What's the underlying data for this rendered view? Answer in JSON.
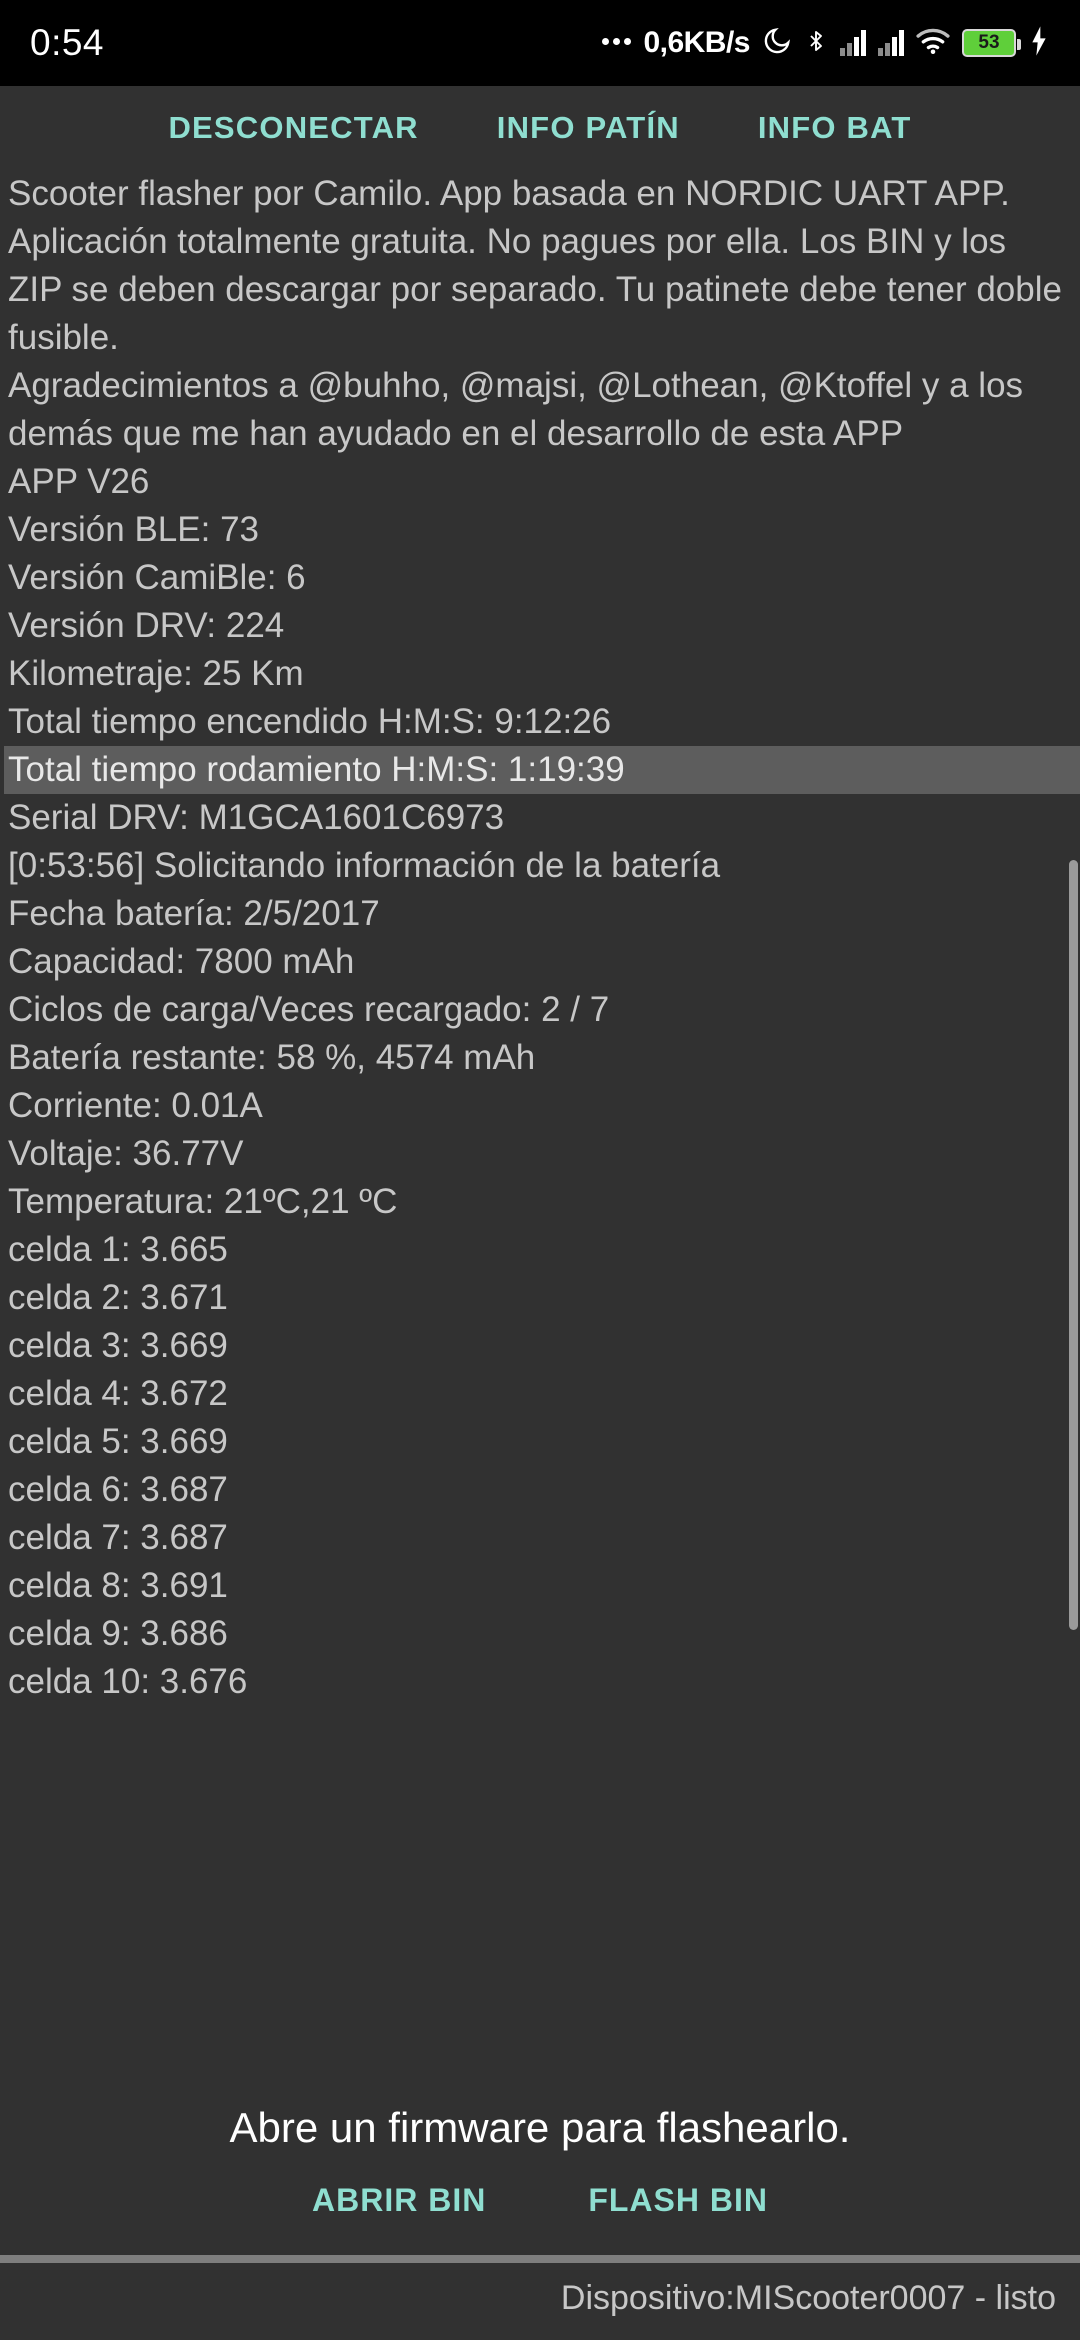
{
  "statusbar": {
    "clock": "0:54",
    "net_speed": "0,6KB/s",
    "battery_percent": "53",
    "icons": [
      "dnd-moon-icon",
      "bluetooth-icon",
      "signal-bars-icon",
      "signal-bars-icon",
      "wifi-icon",
      "battery-icon",
      "charging-bolt-icon"
    ]
  },
  "tabs": [
    {
      "label": "DESCONECTAR",
      "name": "tab-desconectar"
    },
    {
      "label": "INFO PATÍN",
      "name": "tab-info-patin"
    },
    {
      "label": "INFO BAT",
      "name": "tab-info-bat"
    }
  ],
  "log": {
    "lines": [
      {
        "text": "Scooter flasher por Camilo. App basada en NORDIC UART APP. Aplicación totalmente gratuita. No pagues por ella. Los BIN y los ZIP se deben descargar por separado. Tu patinete debe tener doble fusible.",
        "highlight": false
      },
      {
        "text": "Agradecimientos a @buhho, @majsi, @Lothean, @Ktoffel y a los demás que me han ayudado en el desarrollo de esta APP",
        "highlight": false
      },
      {
        "text": "APP V26",
        "highlight": false
      },
      {
        "text": "Versión BLE: 73",
        "highlight": false
      },
      {
        "text": "Versión CamiBle: 6",
        "highlight": false
      },
      {
        "text": "Versión DRV: 224",
        "highlight": false
      },
      {
        "text": "Kilometraje: 25 Km",
        "highlight": false
      },
      {
        "text": "Total tiempo encendido H:M:S: 9:12:26",
        "highlight": false
      },
      {
        "text": "Total tiempo rodamiento H:M:S: 1:19:39",
        "highlight": true
      },
      {
        "text": "Serial DRV: M1GCA1601C6973",
        "highlight": false
      },
      {
        "text": "[0:53:56] Solicitando información de la batería",
        "highlight": false
      },
      {
        "text": "Fecha batería: 2/5/2017",
        "highlight": false
      },
      {
        "text": "Capacidad: 7800 mAh",
        "highlight": false
      },
      {
        "text": "Ciclos de carga/Veces recargado: 2 / 7",
        "highlight": false
      },
      {
        "text": "Batería restante: 58 %, 4574 mAh",
        "highlight": false
      },
      {
        "text": "Corriente: 0.01A",
        "highlight": false
      },
      {
        "text": "Voltaje: 36.77V",
        "highlight": false
      },
      {
        "text": "Temperatura: 21ºC,21 ºC",
        "highlight": false
      },
      {
        "text": "celda 1: 3.665",
        "highlight": false
      },
      {
        "text": "celda 2: 3.671",
        "highlight": false
      },
      {
        "text": "celda 3: 3.669",
        "highlight": false
      },
      {
        "text": "celda 4: 3.672",
        "highlight": false
      },
      {
        "text": "celda 5: 3.669",
        "highlight": false
      },
      {
        "text": "celda 6: 3.687",
        "highlight": false
      },
      {
        "text": "celda 7: 3.687",
        "highlight": false
      },
      {
        "text": "celda 8: 3.691",
        "highlight": false
      },
      {
        "text": "celda 9: 3.686",
        "highlight": false
      },
      {
        "text": "celda 10: 3.676",
        "highlight": false
      }
    ]
  },
  "footer": {
    "flash_message": "Abre un firmware para flashearlo.",
    "buttons": [
      {
        "label": "ABRIR BIN",
        "name": "abrir-bin-button"
      },
      {
        "label": "FLASH BIN",
        "name": "flash-bin-button"
      }
    ],
    "device_status": "Dispositivo:MIScooter0007 - listo"
  },
  "colors": {
    "accent": "#8fded0",
    "background": "#313131",
    "text": "#c7c7c7",
    "highlight_row": "#5d5d5d",
    "battery_green": "#5fcf3a"
  }
}
